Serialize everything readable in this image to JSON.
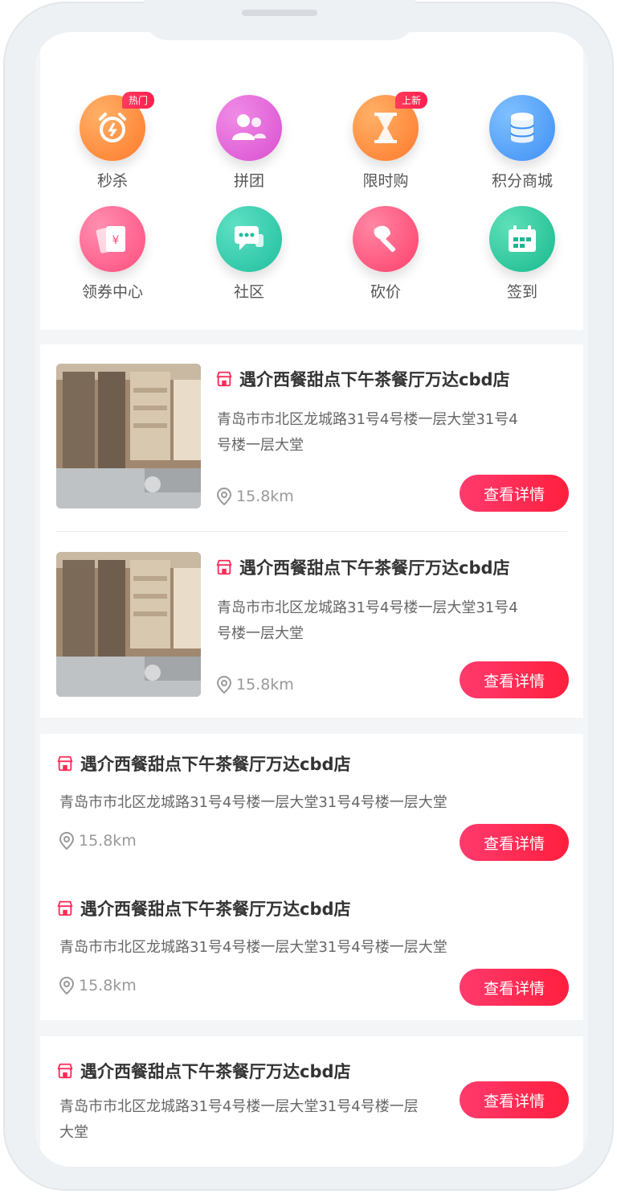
{
  "icons": [
    {
      "label": "秒杀",
      "badge": "热门",
      "icon": "alarm-clock-icon",
      "color": "#ff8a3d"
    },
    {
      "label": "拼团",
      "badge": "",
      "icon": "people-icon",
      "color": "#e85bd3"
    },
    {
      "label": "限时购",
      "badge": "上新",
      "icon": "hourglass-icon",
      "color": "#ff8a3d"
    },
    {
      "label": "积分商城",
      "badge": "",
      "icon": "coins-icon",
      "color": "#4aa3ff"
    },
    {
      "label": "领券中心",
      "badge": "",
      "icon": "coupon-icon",
      "color": "#ff5b8d"
    },
    {
      "label": "社区",
      "badge": "",
      "icon": "chat-icon",
      "color": "#26c7a8"
    },
    {
      "label": "砍价",
      "badge": "",
      "icon": "axe-icon",
      "color": "#ff4d79"
    },
    {
      "label": "签到",
      "badge": "",
      "icon": "calendar-icon",
      "color": "#25c59d"
    }
  ],
  "stores": [
    {
      "title": "遇介西餐甜点下午茶餐厅万达cbd店",
      "address": "青岛市市北区龙城路31号4号楼一层大堂31号4号楼一层大堂",
      "distance": "15.8km",
      "button": "查看详情"
    },
    {
      "title": "遇介西餐甜点下午茶餐厅万达cbd店",
      "address": "青岛市市北区龙城路31号4号楼一层大堂31号4号楼一层大堂",
      "distance": "15.8km",
      "button": "查看详情"
    },
    {
      "title": "遇介西餐甜点下午茶餐厅万达cbd店",
      "address": "青岛市市北区龙城路31号4号楼一层大堂31号4号楼一层大堂",
      "distance": "15.8km",
      "button": "查看详情"
    },
    {
      "title": "遇介西餐甜点下午茶餐厅万达cbd店",
      "address": "青岛市市北区龙城路31号4号楼一层大堂31号4号楼一层大堂",
      "distance": "15.8km",
      "button": "查看详情"
    },
    {
      "title": "遇介西餐甜点下午茶餐厅万达cbd店",
      "address": "青岛市市北区龙城路31号4号楼一层大堂31号4号楼一层大堂",
      "distance": "",
      "button": "查看详情"
    }
  ],
  "colors": {
    "accent": "#ff2a57",
    "text": "#333333",
    "muted": "#999999"
  }
}
